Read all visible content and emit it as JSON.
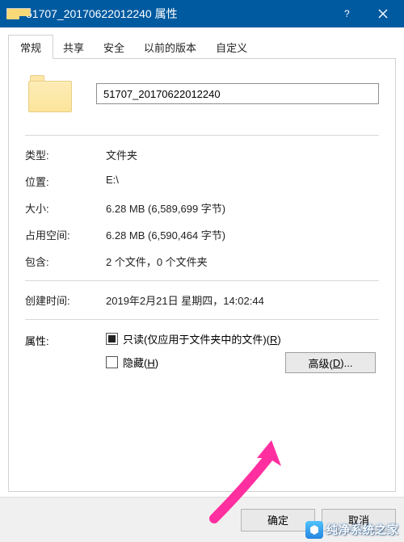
{
  "titlebar": {
    "title": "51707_20170622012240 属性"
  },
  "tabs": [
    "常规",
    "共享",
    "安全",
    "以前的版本",
    "自定义"
  ],
  "active_tab": 0,
  "general": {
    "name_value": "51707_20170622012240",
    "rows": {
      "type_label": "类型:",
      "type_value": "文件夹",
      "location_label": "位置:",
      "location_value": "E:\\",
      "size_label": "大小:",
      "size_value": "6.28 MB (6,589,699 字节)",
      "size_on_disk_label": "占用空间:",
      "size_on_disk_value": "6.28 MB (6,590,464 字节)",
      "contains_label": "包含:",
      "contains_value": "2 个文件，0 个文件夹",
      "created_label": "创建时间:",
      "created_value": "2019年2月21日 星期四，14:02:44",
      "attr_label": "属性:"
    },
    "readonly": {
      "prefix": "只读(仅应用于文件夹中的文件)(",
      "hotkey": "R",
      "suffix": ")"
    },
    "hidden": {
      "prefix": "隐藏(",
      "hotkey": "H",
      "suffix": ")"
    },
    "advanced": {
      "prefix": "高级(",
      "hotkey": "D",
      "suffix": ")..."
    }
  },
  "buttons": {
    "ok": "确定",
    "cancel": "取消"
  },
  "watermark": "纯净系统之家"
}
